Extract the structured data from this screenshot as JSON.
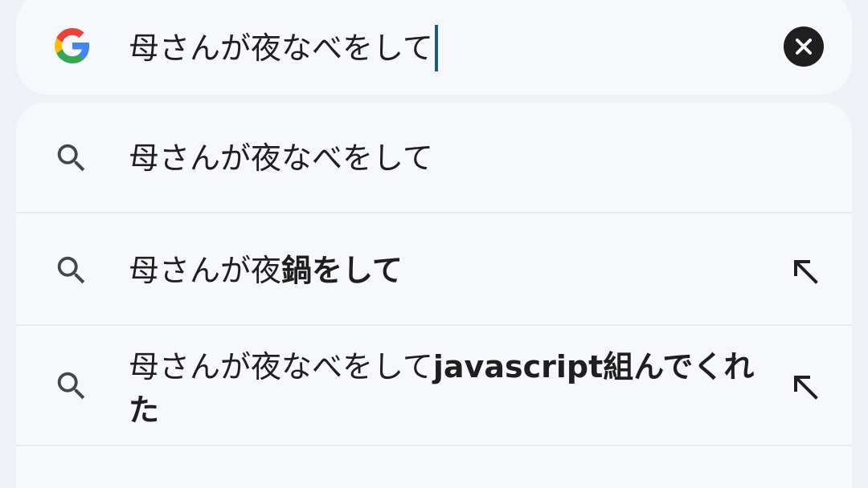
{
  "search": {
    "query": "母さんが夜なべをして"
  },
  "suggestions": [
    {
      "plain": "母さんが夜なべをして",
      "bold": ""
    },
    {
      "plain": "母さんが夜",
      "bold": "鍋をして"
    },
    {
      "plain": "母さんが夜なべをして",
      "bold": "javascript組んでくれた"
    }
  ],
  "icons": {
    "logo": "google-g-icon",
    "clear": "close-icon",
    "search": "search-icon",
    "fill": "arrow-up-left-icon"
  },
  "colors": {
    "caret": "#1a5b86",
    "background": "#eef1f6",
    "surface": "#f6f8fc",
    "google_blue": "#4285F4",
    "google_red": "#EA4335",
    "google_yellow": "#FBBC05",
    "google_green": "#34A853"
  }
}
